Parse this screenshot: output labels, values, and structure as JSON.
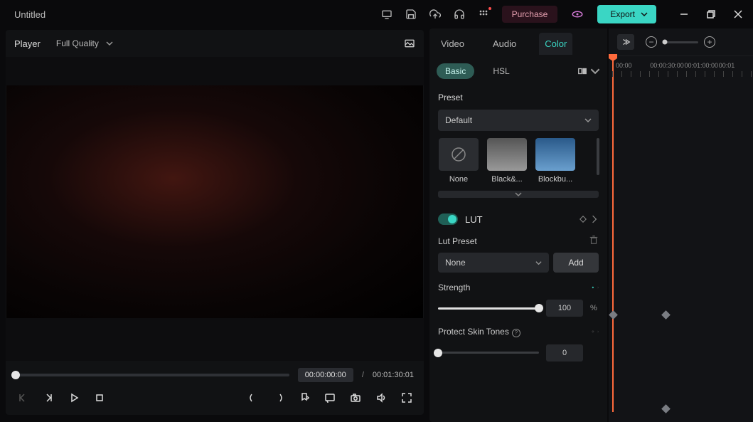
{
  "titlebar": {
    "title": "Untitled"
  },
  "buttons": {
    "purchase": "Purchase",
    "export": "Export"
  },
  "player": {
    "label": "Player",
    "quality": "Full Quality",
    "time_current": "00:00:00:00",
    "time_sep": "/",
    "time_total": "00:01:30:01"
  },
  "inspector": {
    "tabs": {
      "video": "Video",
      "audio": "Audio",
      "color": "Color"
    },
    "subtabs": {
      "basic": "Basic",
      "hsl": "HSL"
    },
    "preset": {
      "title": "Preset",
      "selected": "Default",
      "items": [
        "None",
        "Black&...",
        "Blockbu..."
      ]
    },
    "lut": {
      "label": "LUT",
      "preset_label": "Lut Preset",
      "preset_value": "None",
      "add": "Add",
      "strength_label": "Strength",
      "strength_value": "100",
      "strength_unit": "%",
      "skin_label": "Protect Skin Tones",
      "skin_value": "0"
    }
  },
  "ruler": {
    "labels": [
      "00:00",
      "00:00:30:00",
      "00:01:00:00",
      "00:01"
    ]
  }
}
